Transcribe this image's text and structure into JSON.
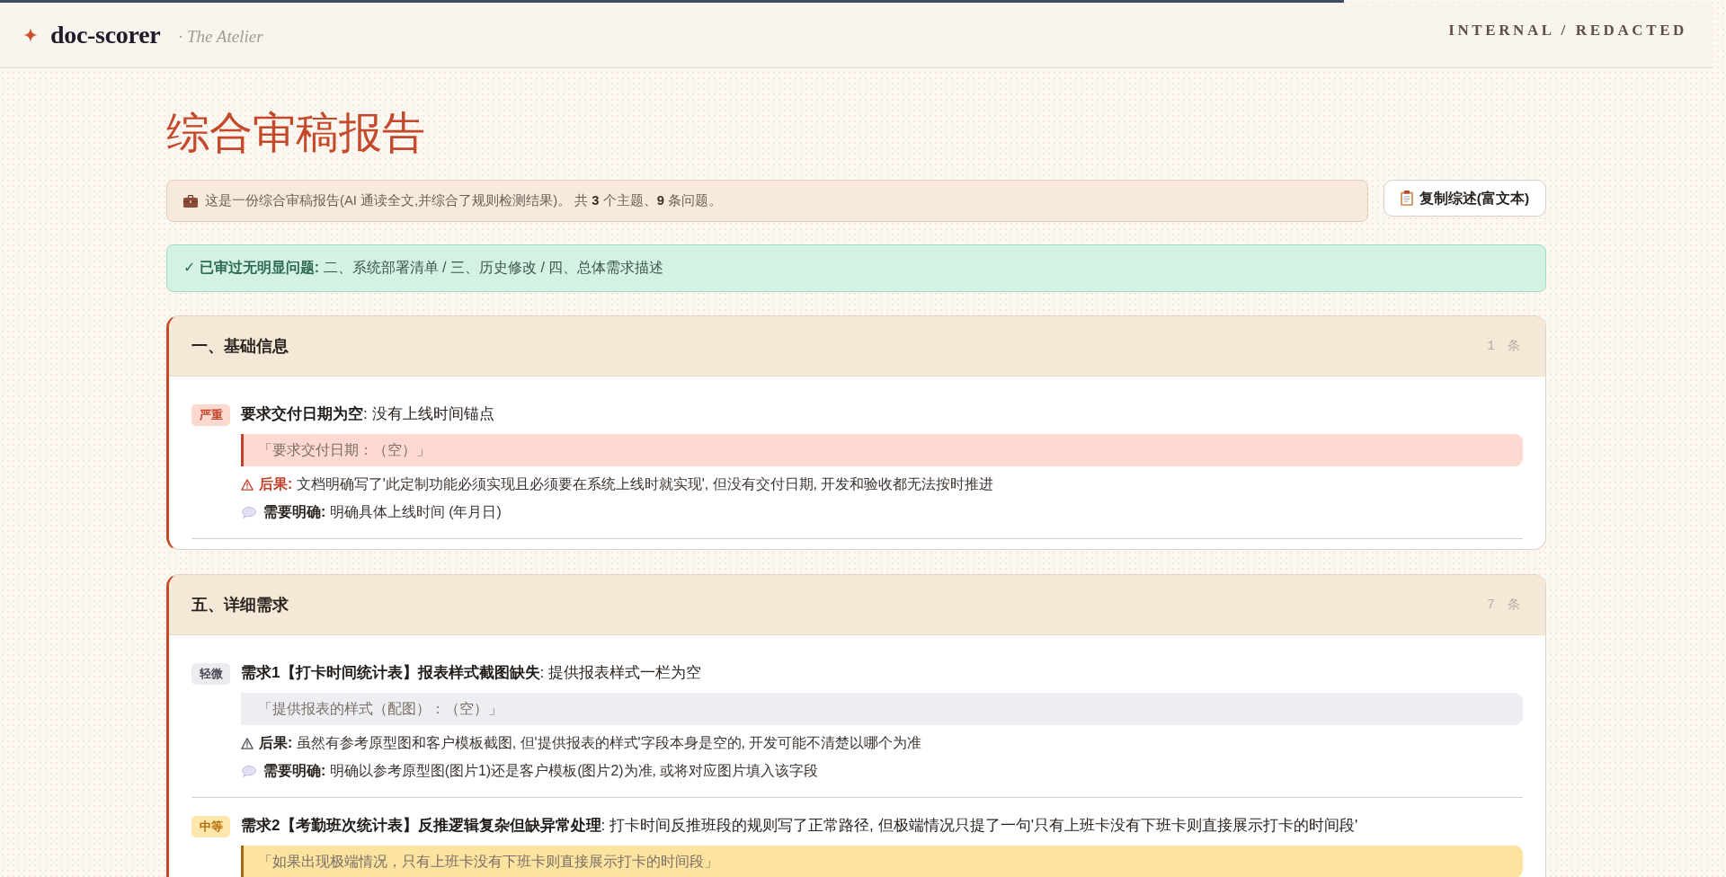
{
  "header": {
    "logo": "doc-scorer",
    "subtitle": "· The Atelier",
    "classification": "INTERNAL / REDACTED"
  },
  "report": {
    "title": "综合审稿报告",
    "summary": "这是一份综合审稿报告(AI 通读全文,并综合了规则检测结果)。 共 **3** 个主题、**9** 条问题。",
    "copy_button": "复制综述(富文本)"
  },
  "passed_notice": "**✓ 已审过无明显问题:** 二、系统部署清单 / 三、历史修改 / 四、总体需求描述",
  "sections": [
    {
      "title": "一、基础信息",
      "count": "1 条",
      "issues": [
        {
          "kind": "critical",
          "badge": "严重",
          "title": "**要求交付日期为空**: 没有上线时间锚点",
          "quote": "「要求交付日期：（空）」",
          "consequence": "**后果:** 文档明确写了'此定制功能必须实现且必须要在系统上线时就实现', 但没有交付日期, 开发和验收都无法按时推进",
          "clarification": "**需要明确:** 明确具体上线时间 (年月日)"
        }
      ]
    },
    {
      "title": "五、详细需求",
      "count": "7 条",
      "issues": [
        {
          "kind": "minor",
          "badge": "轻微",
          "title": "**需求1【打卡时间统计表】报表样式截图缺失**: 提供报表样式一栏为空",
          "quote": "「提供报表的样式（配图）：（空）」",
          "consequence": "**后果:** 虽然有参考原型图和客户模板截图, 但'提供报表的样式'字段本身是空的, 开发可能不清楚以哪个为准",
          "clarification": "**需要明确:** 明确以参考原型图(图片1)还是客户模板(图片2)为准, 或将对应图片填入该字段"
        },
        {
          "kind": "moderate",
          "badge": "中等",
          "title": "**需求2【考勤班次统计表】反推逻辑复杂但缺异常处理**: 打卡时间反推班段的规则写了正常路径, 但极端情况只提了一句'只有上班卡没有下班卡则直接展示打卡的时间段'",
          "quote": "「如果出现极端情况，只有上班卡没有下班卡则直接展示打卡的时间段」"
        }
      ]
    }
  ]
}
